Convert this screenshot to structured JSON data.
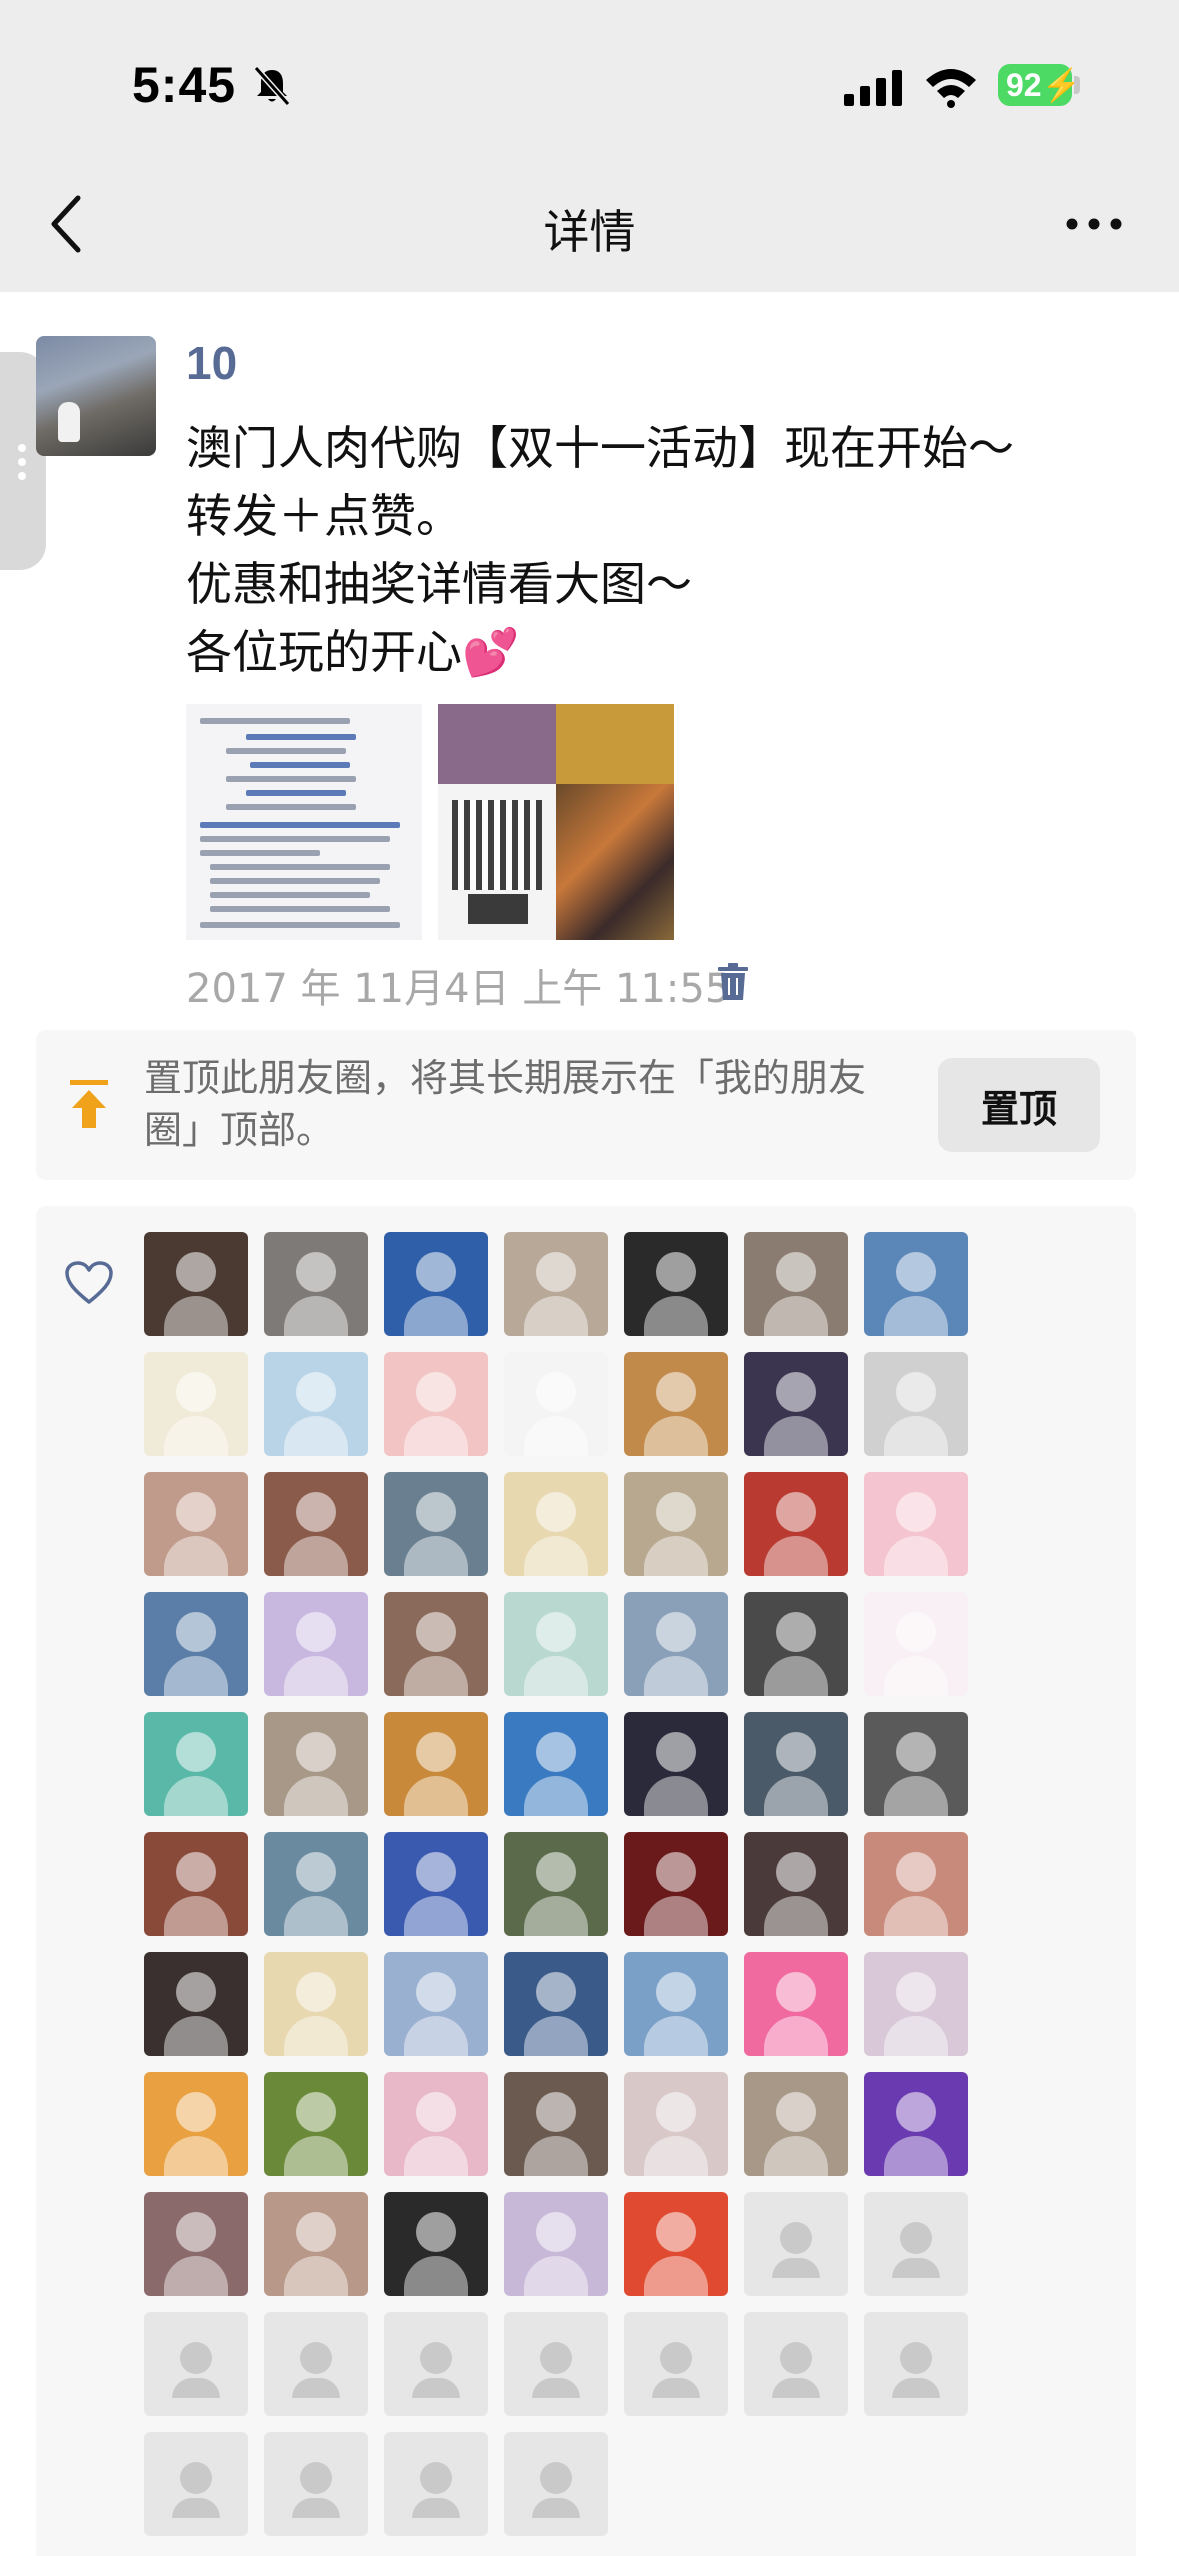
{
  "status_bar": {
    "time": "5:45",
    "battery": "92"
  },
  "nav": {
    "title": "详情",
    "back_icon": "chevron-left-icon",
    "more_icon": "more-icon"
  },
  "post": {
    "author": "10",
    "lines": [
      "澳门人肉代购【双十一活动】现在开始～",
      "转发＋点赞。",
      "优惠和抽奖详情看大图～",
      "各位玩的开心"
    ],
    "emoji": "💕",
    "time": "2017 年 11月4日 上午 11:55"
  },
  "pin": {
    "text": "置顶此朋友圈，将其长期展示在「我的朋友圈」顶部。",
    "button": "置顶"
  },
  "likes": {
    "avatar_colors": [
      "#4a3a32",
      "#7d7a78",
      "#2f5fa8",
      "#b8a898",
      "#2a2a2a",
      "#8a7c70",
      "#5a86b8",
      "#f0ead8",
      "#b9d4e6",
      "#f2c4c4",
      "#f4f4f4",
      "#c28a4a",
      "#3b3550",
      "#d0d0d0",
      "#c09a8a",
      "#8a5a4a",
      "#6a8090",
      "#e8d8b0",
      "#b8a890",
      "#b83a30",
      "#f4c4d0",
      "#5a7ea8",
      "#c8b8e0",
      "#8a6a5a",
      "#b8d8d0",
      "#8aa0b8",
      "#4a4a4a",
      "#f8f0f4",
      "#5ab8a8",
      "#a89888",
      "#c88a3a",
      "#3a7ac0",
      "#2a2a3a",
      "#4a5a68",
      "#5a5a5a",
      "#8a4a3a",
      "#6a8aa0",
      "#3a5ab0",
      "#5a6a4a",
      "#6a1a1a",
      "#4a3a3a",
      "#c88a7a",
      "#3a3030",
      "#e8d8b0",
      "#9ab0d0",
      "#3a5a8a",
      "#7aa0c8",
      "#f06aa0",
      "#d8c8d8",
      "#e8a040",
      "#6a8a3a",
      "#e8b8c8",
      "#6a5a50",
      "#d8c8c8",
      "#a89888",
      "#6a3ab0",
      "#8a6a6a",
      "#b89888",
      "#2a2a2a",
      "#c8b8d8",
      "#e04a30"
    ],
    "empty_count": 13
  }
}
